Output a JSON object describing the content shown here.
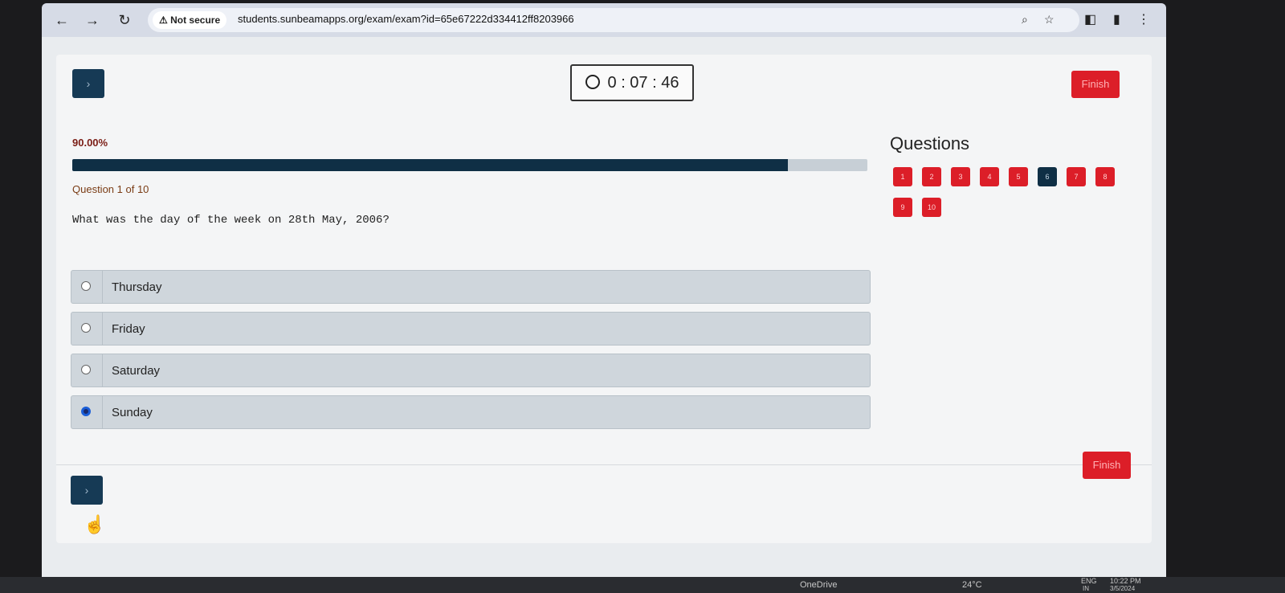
{
  "browser": {
    "security_label": "⚠ Not secure",
    "url": "students.sunbeamapps.org/exam/exam?id=65e67222d334412ff8203966",
    "icons": [
      "back-icon",
      "forward-icon",
      "reload-icon",
      "zoom-icon",
      "star-icon",
      "extension-icon",
      "profile-icon",
      "menu-icon"
    ]
  },
  "timer": {
    "value": "0 : 07 : 46"
  },
  "top_nav": {
    "next_label": "›",
    "finish_label": "Finish"
  },
  "progress": {
    "percent_label": "90.00%",
    "fill_fraction": 0.9
  },
  "question": {
    "counter": "Question 1 of 10",
    "text": "What was the day of the week on 28th May, 2006?",
    "options": [
      {
        "label": "Thursday",
        "selected": false
      },
      {
        "label": "Friday",
        "selected": false
      },
      {
        "label": "Saturday",
        "selected": false
      },
      {
        "label": "Sunday",
        "selected": true
      }
    ]
  },
  "questions_panel": {
    "title": "Questions",
    "numbers": [
      "1",
      "2",
      "3",
      "4",
      "5",
      "6",
      "7",
      "8",
      "9",
      "10"
    ],
    "active": "6"
  },
  "bottom_nav": {
    "next_label": "›",
    "finish_label": "Finish"
  },
  "taskbar": {
    "onedrive": "OneDrive",
    "temperature": "24°C",
    "lang": "ENG",
    "region": "IN",
    "time": "10:22 PM",
    "date": "3/5/2024"
  },
  "colors": {
    "accent_dark": "#0f2f45",
    "finish_red": "#dc1e28",
    "radio_blue": "#1a5ed8"
  }
}
